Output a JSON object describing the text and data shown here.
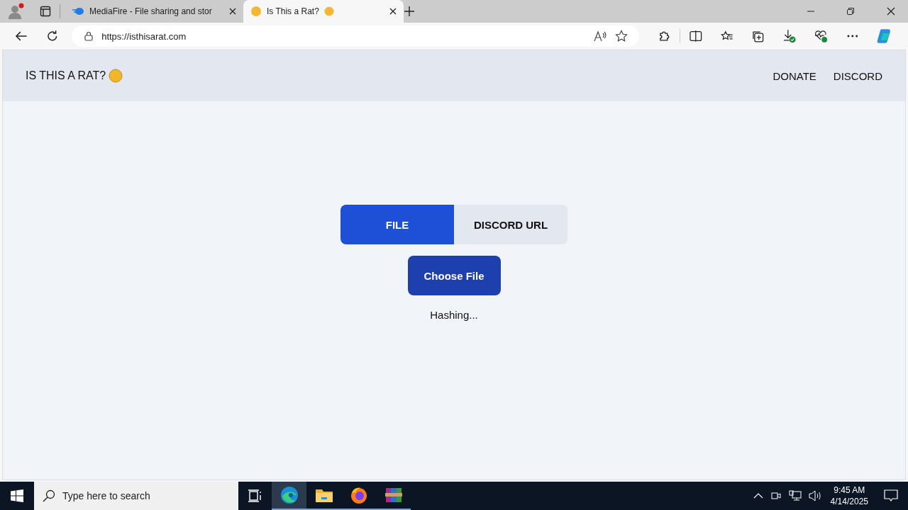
{
  "browser": {
    "tabs": [
      {
        "title": "MediaFire - File sharing and stor",
        "kind": "mediafire",
        "selected": false
      },
      {
        "title": "Is This a Rat?",
        "kind": "emoji",
        "selected": true
      }
    ],
    "address": "https://isthisarat.com"
  },
  "site": {
    "logo": "IS THIS A RAT?",
    "nav": [
      "DONATE",
      "DISCORD"
    ]
  },
  "mode_tabs": [
    {
      "label": "FILE",
      "selected": true
    },
    {
      "label": "DISCORD URL",
      "selected": false
    }
  ],
  "choose_button": "Choose File",
  "status": "Hashing...",
  "taskbar": {
    "search_placeholder": "Type here to search",
    "time": "9:45 AM",
    "date": "4/14/2025",
    "apps": [
      {
        "kind": "edge",
        "selected": true
      },
      {
        "kind": "folder",
        "selected": false
      },
      {
        "kind": "firefox",
        "selected": false
      },
      {
        "kind": "archive",
        "selected": false
      }
    ]
  }
}
